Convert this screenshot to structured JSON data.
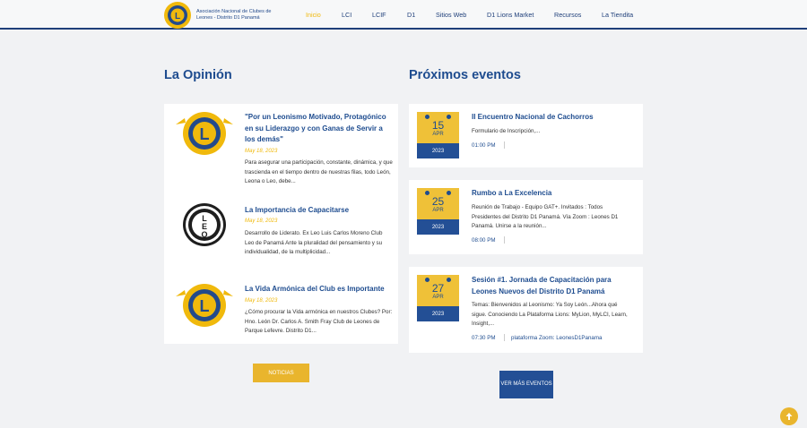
{
  "header": {
    "logo_text": "Asociación Nacional de Clubes de Leones - Distrito D1 Panamá",
    "nav": [
      {
        "label": "Inicio",
        "active": true
      },
      {
        "label": "LCI"
      },
      {
        "label": "LCIF"
      },
      {
        "label": "D1"
      },
      {
        "label": "Sitios Web"
      },
      {
        "label": "D1 Lions Market"
      },
      {
        "label": "Recursos"
      },
      {
        "label": "La Tiendita"
      }
    ]
  },
  "opinion": {
    "title": "La Opinión",
    "items": [
      {
        "logo": "lions-international-logo",
        "title": "\"Por un Leonismo Motivado, Protagónico en su Liderazgo y con Ganas de Servir a los demás\"",
        "date": "May 18, 2023",
        "text": "Para asegurar una participación, constante, dinámica, y que trascienda en el tiempo dentro de nuestras filas, todo León, Leona o Leo, debe..."
      },
      {
        "logo": "leo-club-logo",
        "title": "La Importancia de Capacitarse",
        "date": "May 18, 2023",
        "text": "Desarrollo de Liderato. Ex Leo Luis Carlos Moreno Club Leo de Panamá Ante la pluralidad del pensamiento y su individualidad, de la multiplicidad..."
      },
      {
        "logo": "lions-international-logo",
        "title": "La Vida Armónica del Club es Importante",
        "date": "May 18, 2023",
        "text": "¿Cómo procurar la Vida armónica en nuestros Clubes? Por: Hno. León Dr. Carlos A. Smith Fray Club de Leones de Parque Lefevre. Distrito D1..."
      }
    ],
    "button": "NOTICIAS"
  },
  "events": {
    "title": "Próximos eventos",
    "items": [
      {
        "day": "15",
        "month": "APR",
        "year": "2023",
        "title": "II Encuentro Nacional de Cachorros",
        "text": "Formulario de Inscripción,...",
        "time": "01:00 PM",
        "location": ""
      },
      {
        "day": "25",
        "month": "APR",
        "year": "2023",
        "title": "Rumbo a La Excelencia",
        "text": "Reunión de Trabajo - Equipo GAT+. Invitados : Todos Presidentes del Distrito D1 Panamá. Vía Zoom : Leones D1 Panamá. Unirse a la reunión...",
        "time": "08:00 PM",
        "location": ""
      },
      {
        "day": "27",
        "month": "APR",
        "year": "2023",
        "title": "Sesión #1. Jornada de Capacitación para Leones Nuevos del Distrito D1 Panamá",
        "text": "Temas: Bienvenidos al Leonismo: Ya Soy León...Ahora qué sigue. Conociendo La Plataforma Lions: MyLion, MyLCI, Learn, Insight,...",
        "time": "07:30 PM",
        "location": "plataforma Zoom: LeonesD1Panama"
      }
    ],
    "button": "VER MÁS EVENTOS"
  },
  "colors": {
    "brand_blue": "#1e4c8f",
    "brand_yellow": "#efc138",
    "background": "#f1f2f4"
  },
  "icons": {
    "scroll_top": "arrow-up-icon"
  }
}
